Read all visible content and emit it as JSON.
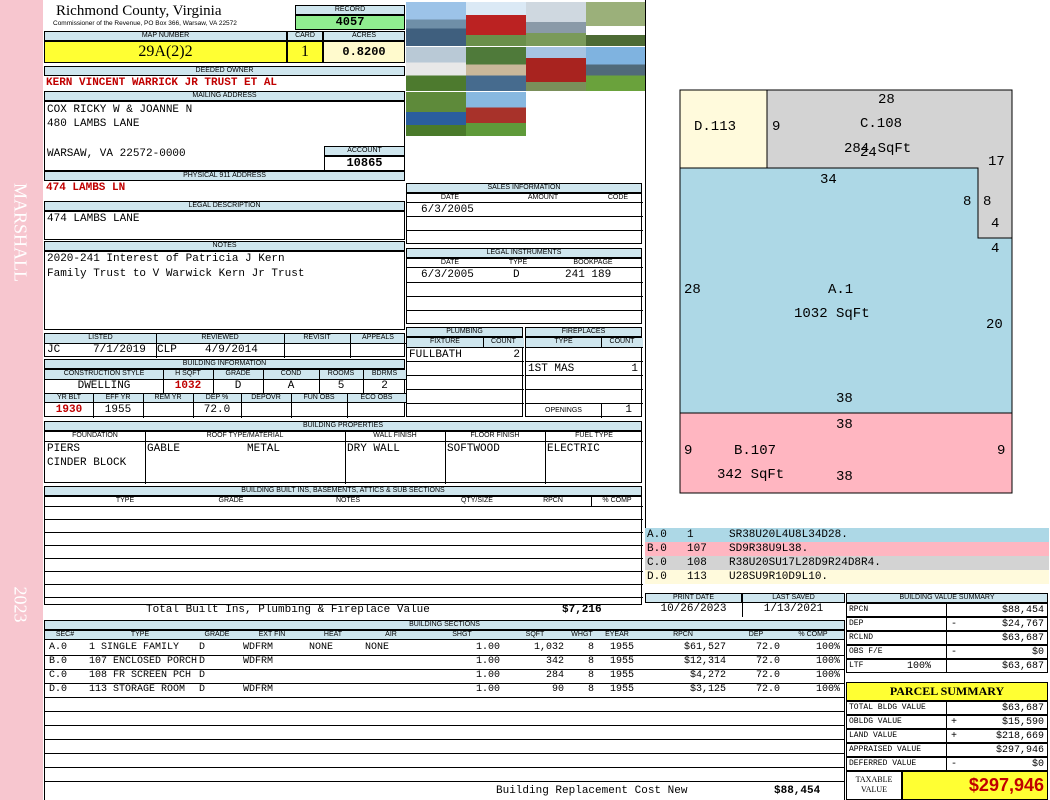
{
  "sidebar": {
    "top": "MARSHALL",
    "bottom": "2023"
  },
  "header": {
    "county": "Richmond County, Virginia",
    "commissioner": "Commissioner of the Revenue, PO Box 366, Warsaw, VA 22572",
    "record_label": "RECORD",
    "record": "4057",
    "map_label": "MAP NUMBER",
    "map": "29A(2)2",
    "card_label": "CARD",
    "card": "1",
    "acres_label": "ACRES",
    "acres": "0.8200"
  },
  "owner": {
    "deeded_label": "DEEDED OWNER",
    "deeded": "KERN VINCENT WARRICK JR TRUST ET AL",
    "mailing_label": "MAILING ADDRESS",
    "mail1": "COX RICKY W & JOANNE N",
    "mail2": "480 LAMBS LANE",
    "mail3": "WARSAW, VA 22572-0000",
    "account_label": "ACCOUNT",
    "account": "10865"
  },
  "physical": {
    "label": "PHYSICAL 911 ADDRESS",
    "value": "474 LAMBS LN"
  },
  "legal": {
    "label": "LEGAL DESCRIPTION",
    "value": "474 LAMBS LANE"
  },
  "notes": {
    "label": "NOTES",
    "line1": "2020-241 Interest of Patricia J Kern",
    "line2": "Family Trust to V Warwick Kern Jr Trust"
  },
  "sales": {
    "label": "SALES INFORMATION",
    "h_date": "DATE",
    "h_amount": "AMOUNT",
    "h_code": "CODE",
    "date": "6/3/2005"
  },
  "instruments": {
    "label": "LEGAL INSTRUMENTS",
    "h_date": "DATE",
    "h_type": "TYPE",
    "h_book": "BOOKPAGE",
    "date": "6/3/2005",
    "type": "D",
    "book": "241 189"
  },
  "review": {
    "h_listed": "LISTED",
    "h_reviewed": "REVIEWED",
    "h_revisit": "REVISIT",
    "h_appeals": "APPEALS",
    "listed_by": "JC",
    "listed_date": "7/1/2019",
    "reviewed_by": "CLP",
    "reviewed_date": "4/9/2014"
  },
  "building_info": {
    "label": "BUILDING INFORMATION",
    "h_style": "CONSTRUCTION STYLE",
    "h_hsqft": "H SQFT",
    "h_grade": "GRADE",
    "h_cond": "COND",
    "h_rooms": "ROOMS",
    "h_bdrms": "BDRMS",
    "style": "DWELLING",
    "hsqft": "1032",
    "grade": "D",
    "cond": "A",
    "rooms": "5",
    "bdrms": "2",
    "h_yrblt": "YR BLT",
    "h_effyr": "EFF YR",
    "h_remyr": "REM YR",
    "h_dep": "DEP %",
    "h_depovr": "DEPOVR",
    "h_funobs": "FUN OBS",
    "h_ecoobs": "ECO OBS",
    "yrblt": "1930",
    "effyr": "1955",
    "dep": "72.0"
  },
  "plumbing": {
    "label": "PLUMBING",
    "h_fixture": "FIXTURE",
    "h_count": "COUNT",
    "fixture": "FULLBATH",
    "count": "2"
  },
  "fireplaces": {
    "label": "FIREPLACES",
    "h_type": "TYPE",
    "h_count": "COUNT",
    "type": "1ST MAS",
    "count": "1",
    "openings_label": "OPENINGS",
    "openings": "1"
  },
  "properties": {
    "label": "BUILDING PROPERTIES",
    "h_foundation": "FOUNDATION",
    "h_roof": "ROOF TYPE/MATERIAL",
    "h_wall": "WALL FINISH",
    "h_floor": "FLOOR FINISH",
    "h_fuel": "FUEL TYPE",
    "foundation1": "PIERS",
    "foundation2": "CINDER BLOCK",
    "roof_type": "GABLE",
    "roof_material": "METAL",
    "wall": "DRY WALL",
    "floor": "SOFTWOOD",
    "fuel": "ELECTRIC"
  },
  "builtins": {
    "label": "BUILDING BUILT INS, BASEMENTS, ATTICS & SUB SECTIONS",
    "h_type": "TYPE",
    "h_grade": "GRADE",
    "h_notes": "NOTES",
    "h_qty": "QTY/SIZE",
    "h_rpcn": "RPCN",
    "h_comp": "% COMP",
    "total_label": "Total Built Ins, Plumbing & Fireplace Value",
    "total": "$7,216"
  },
  "dates": {
    "print_label": "PRINT DATE",
    "print": "10/26/2023",
    "saved_label": "LAST SAVED",
    "saved": "1/13/2021"
  },
  "sections": {
    "label": "BUILDING SECTIONS",
    "headers": [
      "SEC#",
      "TYPE",
      "GRADE",
      "EXT FIN",
      "HEAT",
      "AIR",
      "SHGT",
      "SQFT",
      "WHGT",
      "EYEAR",
      "RPCN",
      "DEP",
      "% COMP"
    ],
    "rows": [
      [
        "A.0",
        "1 SINGLE FAMILY",
        "D",
        "WDFRM",
        "NONE",
        "NONE",
        "1.00",
        "1,032",
        "8",
        "1955",
        "$61,527",
        "72.0",
        "100%"
      ],
      [
        "B.0",
        "107 ENCLOSED PORCH",
        "D",
        "WDFRM",
        "",
        "",
        "1.00",
        "342",
        "8",
        "1955",
        "$12,314",
        "72.0",
        "100%"
      ],
      [
        "C.0",
        "108 FR SCREEN PCH",
        "D",
        "",
        "",
        "",
        "1.00",
        "284",
        "8",
        "1955",
        "$4,272",
        "72.0",
        "100%"
      ],
      [
        "D.0",
        "113 STORAGE ROOM",
        "D",
        "WDFRM",
        "",
        "",
        "1.00",
        "90",
        "8",
        "1955",
        "$3,125",
        "72.0",
        "100%"
      ]
    ],
    "total_label": "Building Replacement Cost New",
    "total": "$88,454"
  },
  "sketch": {
    "legend": [
      {
        "code": "A.0",
        "num": "1",
        "vector": "SR38U20L4U8L34D28.",
        "color": "#add8e6"
      },
      {
        "code": "B.0",
        "num": "107",
        "vector": "SD9R38U9L38.",
        "color": "#ffb6c1"
      },
      {
        "code": "C.0",
        "num": "108",
        "vector": "R38U20SU17L28D9R24D8R4.",
        "color": "#d3d3d3"
      },
      {
        "code": "D.0",
        "num": "113",
        "vector": "U28SU9R10D9L10.",
        "color": "#fffadc"
      }
    ],
    "labels": {
      "d_name": "D.113",
      "c_name": "C.108",
      "c_area": "284 SqFt",
      "a_name": "A.1",
      "a_area": "1032 SqFt",
      "b_name": "B.107",
      "b_area": "342 SqFt"
    },
    "dims": {
      "d_right": "9",
      "c_top": "28",
      "c_ovl": "24",
      "c_right": "17",
      "a_top": "34",
      "a_left": "28",
      "a_right": "20",
      "a_bottom": "38",
      "n8a": "8",
      "n8b": "8",
      "n4a": "4",
      "n4b": "4",
      "b_top": "38",
      "b_left": "9",
      "b_right": "9",
      "b_bottom": "38"
    }
  },
  "value_summary": {
    "label": "BUILDING VALUE SUMMARY",
    "rows": [
      {
        "k": "RPCN",
        "s": "",
        "v": "$88,454"
      },
      {
        "k": "DEP",
        "s": "-",
        "v": "$24,767"
      },
      {
        "k": "RCLND",
        "s": "",
        "v": "$63,687"
      },
      {
        "k": "OBS F/E",
        "s": "-",
        "v": "$0"
      },
      {
        "k": "LTF",
        "s": "100%",
        "v": "$63,687"
      }
    ]
  },
  "parcel": {
    "label": "PARCEL SUMMARY",
    "rows": [
      {
        "k": "TOTAL BLDG VALUE",
        "s": "",
        "v": "$63,687"
      },
      {
        "k": "OBLDG VALUE",
        "s": "+",
        "v": "$15,590"
      },
      {
        "k": "LAND VALUE",
        "s": "+",
        "v": "$218,669"
      },
      {
        "k": "APPRAISED VALUE",
        "s": "",
        "v": "$297,946"
      },
      {
        "k": "DEFERRED VALUE",
        "s": "-",
        "v": "$0"
      }
    ],
    "taxable_label1": "TAXABLE",
    "taxable_label2": "VALUE",
    "taxable": "$297,946"
  }
}
